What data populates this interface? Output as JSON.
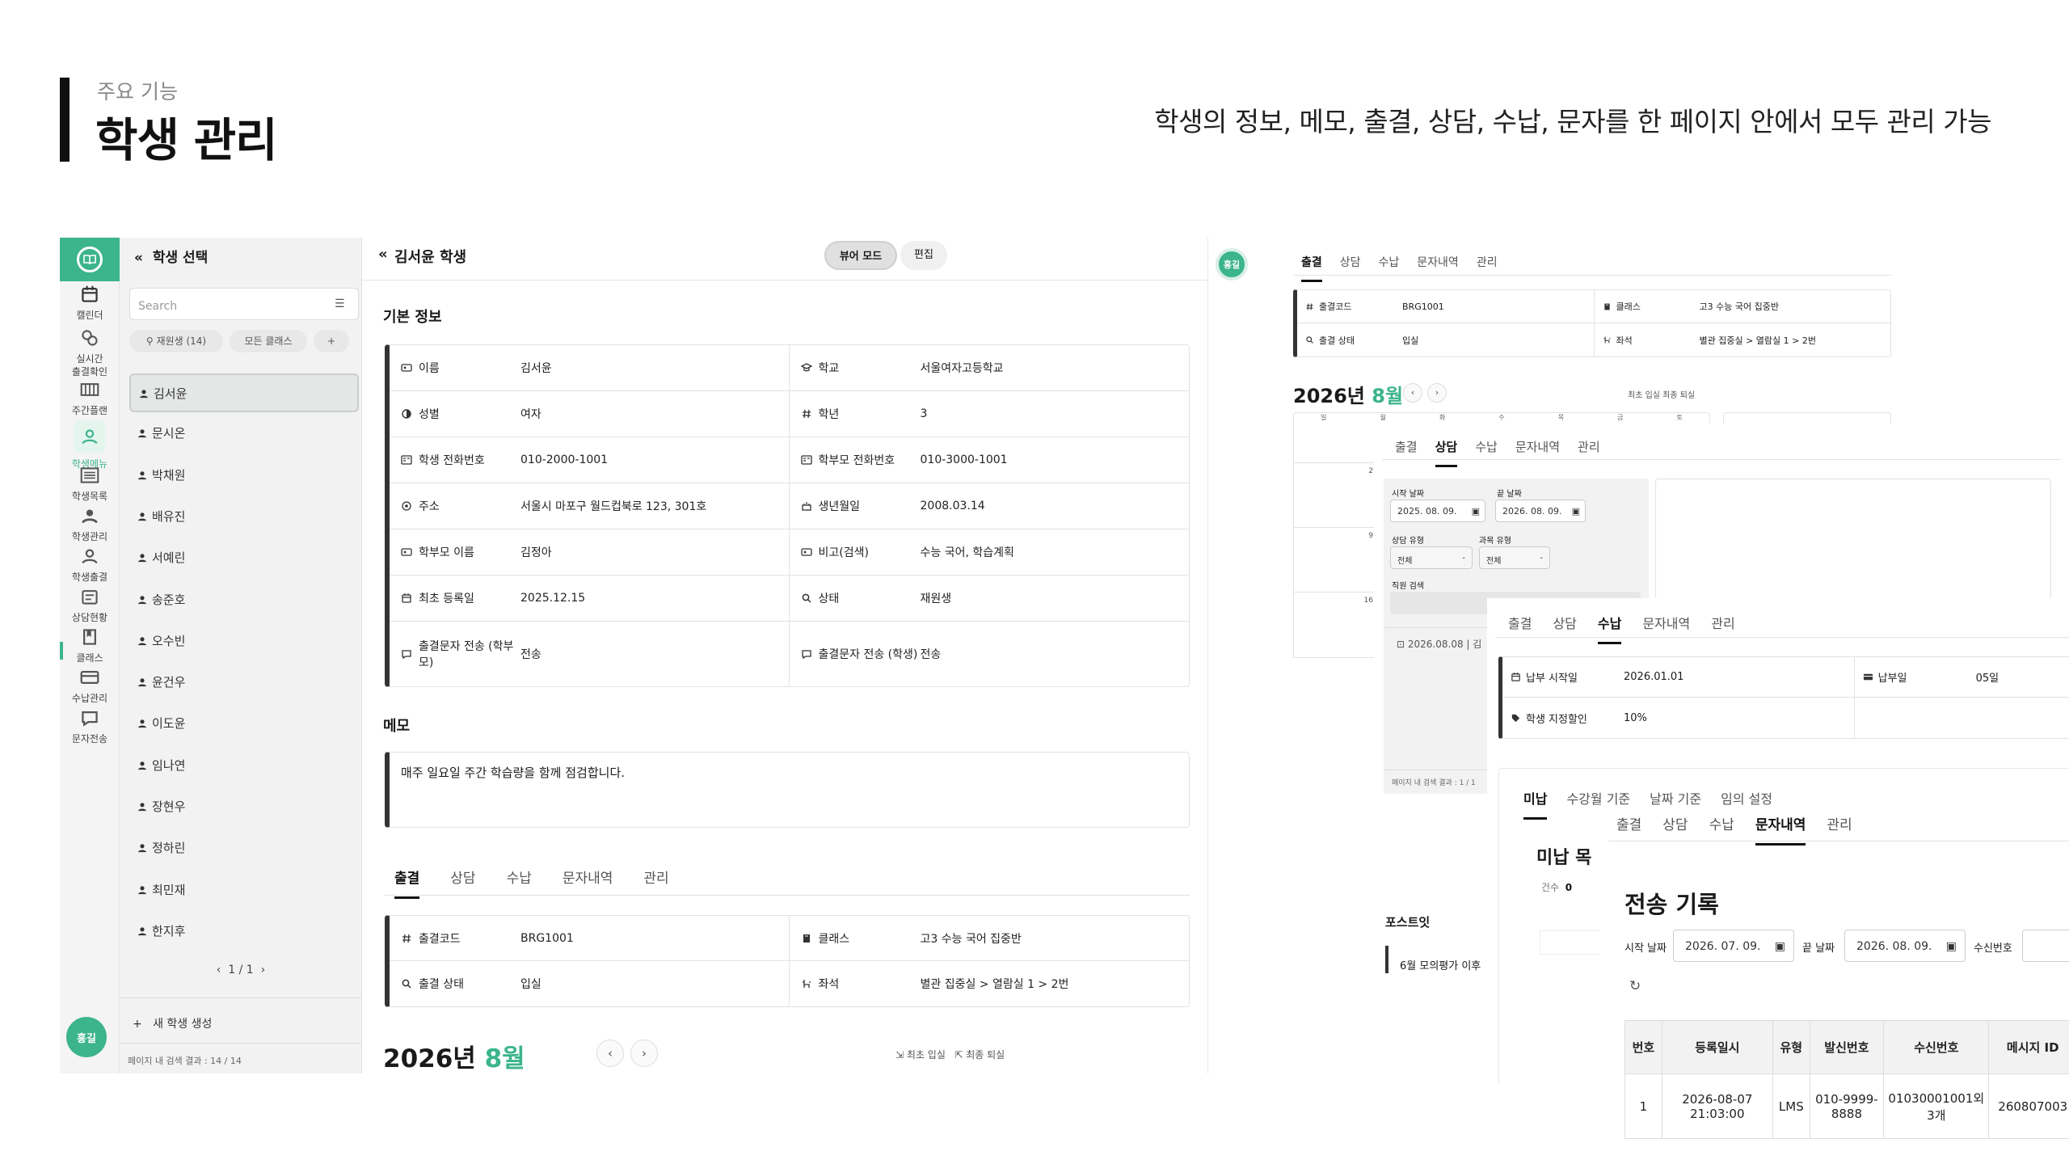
{
  "header": {
    "subtitle": "주요 기능",
    "title": "학생 관리",
    "description": "학생의 정보, 메모, 출결, 상담, 수납, 문자를 한 페이지 안에서 모두 관리 가능"
  },
  "colors": {
    "accent": "#3cb48c",
    "dark": "#111111",
    "bg": "#f2f2f2"
  },
  "rail": {
    "items": [
      {
        "label": "캘린더",
        "icon": "calendar-icon"
      },
      {
        "label": "실시간\n출결확인",
        "icon": "realtime-check-icon"
      },
      {
        "label": "주간플랜",
        "icon": "weekly-plan-icon"
      },
      {
        "label": "학생메뉴",
        "icon": "student-menu-icon"
      },
      {
        "label": "학생목록",
        "icon": "list-icon"
      },
      {
        "label": "학생관리",
        "icon": "student-manage-icon"
      },
      {
        "label": "학생출결",
        "icon": "attendance-icon"
      },
      {
        "label": "상담현황",
        "icon": "consult-icon"
      },
      {
        "label": "클래스",
        "icon": "class-icon"
      },
      {
        "label": "수납관리",
        "icon": "payment-icon"
      },
      {
        "label": "문자전송",
        "icon": "message-icon"
      }
    ],
    "avatar": "홍길"
  },
  "student_panel": {
    "title": "학생 선택",
    "search_placeholder": "Search",
    "chip_status": "재원생 (14)",
    "chip_class": "모든 클래스",
    "chip_add": "+",
    "students": [
      "김서윤",
      "문시온",
      "박채원",
      "배유진",
      "서예린",
      "송준호",
      "오수빈",
      "윤건우",
      "이도윤",
      "임나연",
      "장현우",
      "정하린",
      "최민재",
      "한지후"
    ],
    "pager": "1 / 1",
    "new_student": "새 학생 생성",
    "footer": "페이지 내 검색 결과 : 14 / 14"
  },
  "detail": {
    "title": "김서윤 학생",
    "view_mode": "뷰어 모드",
    "edit": "편집",
    "basic_info_title": "기본 정보",
    "basic_info": [
      [
        {
          "label": "이름",
          "value": "김서윤",
          "icon": "id-card-icon"
        },
        {
          "label": "학교",
          "value": "서울여자고등학교",
          "icon": "school-icon"
        }
      ],
      [
        {
          "label": "성별",
          "value": "여자",
          "icon": "gender-icon"
        },
        {
          "label": "학년",
          "value": "3",
          "icon": "hash-icon"
        }
      ],
      [
        {
          "label": "학생 전화번호",
          "value": "010-2000-1001",
          "icon": "phone-card-icon"
        },
        {
          "label": "학부모 전화번호",
          "value": "010-3000-1001",
          "icon": "phone-card-icon"
        }
      ],
      [
        {
          "label": "주소",
          "value": "서울시 마포구 월드컵북로 123, 301호",
          "icon": "location-icon"
        },
        {
          "label": "생년월일",
          "value": "2008.03.14",
          "icon": "cake-icon"
        }
      ],
      [
        {
          "label": "학부모 이름",
          "value": "김정아",
          "icon": "id-card-icon"
        },
        {
          "label": "비고(검색)",
          "value": "수능 국어, 학습계획",
          "icon": "id-card-icon"
        }
      ],
      [
        {
          "label": "최초 등록일",
          "value": "2025.12.15",
          "icon": "calendar-icon"
        },
        {
          "label": "상태",
          "value": "재원생",
          "icon": "search-icon"
        }
      ],
      [
        {
          "label": "출결문자 전송 (학부모)",
          "value": "전송",
          "icon": "message-icon"
        },
        {
          "label": "출결문자 전송 (학생)",
          "value": "전송",
          "icon": "message-icon"
        }
      ]
    ],
    "memo_title": "메모",
    "memo": "매주 일요일 주간 학습량을 함께 점검합니다.",
    "tabs": [
      "출결",
      "상담",
      "수납",
      "문자내역",
      "관리"
    ],
    "attendance_info": [
      [
        {
          "label": "출결코드",
          "value": "BRG1001",
          "icon": "hash-icon"
        },
        {
          "label": "클래스",
          "value": "고3 수능 국어 집중반",
          "icon": "book-icon"
        }
      ],
      [
        {
          "label": "출결 상태",
          "value": "입실",
          "icon": "search-icon"
        },
        {
          "label": "좌석",
          "value": "별관 집중실 > 열람실 1 > 2번",
          "icon": "seat-icon"
        }
      ]
    ],
    "calendar_year": "2026년",
    "calendar_month": "8월",
    "legend_in": "최초 입실",
    "legend_out": "최종 퇴실"
  },
  "panel_a": {
    "badge": "홍길",
    "tabs": [
      "출결",
      "상담",
      "수납",
      "문자내역",
      "관리"
    ],
    "info": [
      [
        {
          "label": "출결코드",
          "value": "BRG1001"
        },
        {
          "label": "클래스",
          "value": "고3 수능 국어 집중반"
        }
      ],
      [
        {
          "label": "출결 상태",
          "value": "입실"
        },
        {
          "label": "좌석",
          "value": "별관 집중실 > 열람실 1 > 2번"
        }
      ]
    ],
    "calendar_year": "2026년",
    "calendar_month": "8월",
    "legend": "최초 입실  최종 퇴실",
    "days": [
      "일",
      "월",
      "화",
      "수",
      "목",
      "금",
      "토"
    ],
    "week_nums": [
      "2",
      "9",
      "16"
    ],
    "postit_title": "포스트잇",
    "postit_text": "6월 모의평가 이후"
  },
  "panel_b": {
    "tabs": [
      "출결",
      "상담",
      "수납",
      "문자내역",
      "관리"
    ],
    "start_label": "시작 날짜",
    "end_label": "끝 날짜",
    "start_date": "2025. 08. 09.",
    "end_date": "2026. 08. 09.",
    "type_label": "상담 유형",
    "subject_label": "과목 유형",
    "type_value": "전체",
    "subject_value": "전체",
    "teacher_label": "직원 검색",
    "record": "2026.08.08 | 김",
    "footer": "페이지 내 검색 결과 : 1 / 1"
  },
  "panel_c": {
    "tabs": [
      "출결",
      "상담",
      "수납",
      "문자내역",
      "관리"
    ],
    "info": [
      [
        {
          "label": "납부 시작일",
          "value": "2026.01.01"
        },
        {
          "label": "납부일",
          "value": "05일"
        }
      ],
      [
        {
          "label": "학생 지정할인",
          "value": "10%"
        },
        {
          "label": "",
          "value": ""
        }
      ]
    ],
    "subtabs": [
      "미납",
      "수강월 기준",
      "날짜 기준",
      "임의 설정"
    ],
    "unpaid_title": "미납 목",
    "count_label": "건수",
    "count_value": "0"
  },
  "panel_d": {
    "tabs": [
      "출결",
      "상담",
      "수납",
      "문자내역",
      "관리"
    ],
    "title": "전송 기록",
    "start_label": "시작 날짜",
    "start_date": "2026. 07. 09.",
    "end_label": "끝 날짜",
    "end_date": "2026. 08. 09.",
    "receiver_label": "수신번호",
    "columns": [
      "번호",
      "등록일시",
      "유형",
      "발신번호",
      "수신번호",
      "메시지 ID"
    ],
    "rows": [
      [
        "1",
        "2026-08-07 21:03:00",
        "LMS",
        "010-9999-8888",
        "01030001001외 3개",
        "260807003"
      ]
    ]
  }
}
